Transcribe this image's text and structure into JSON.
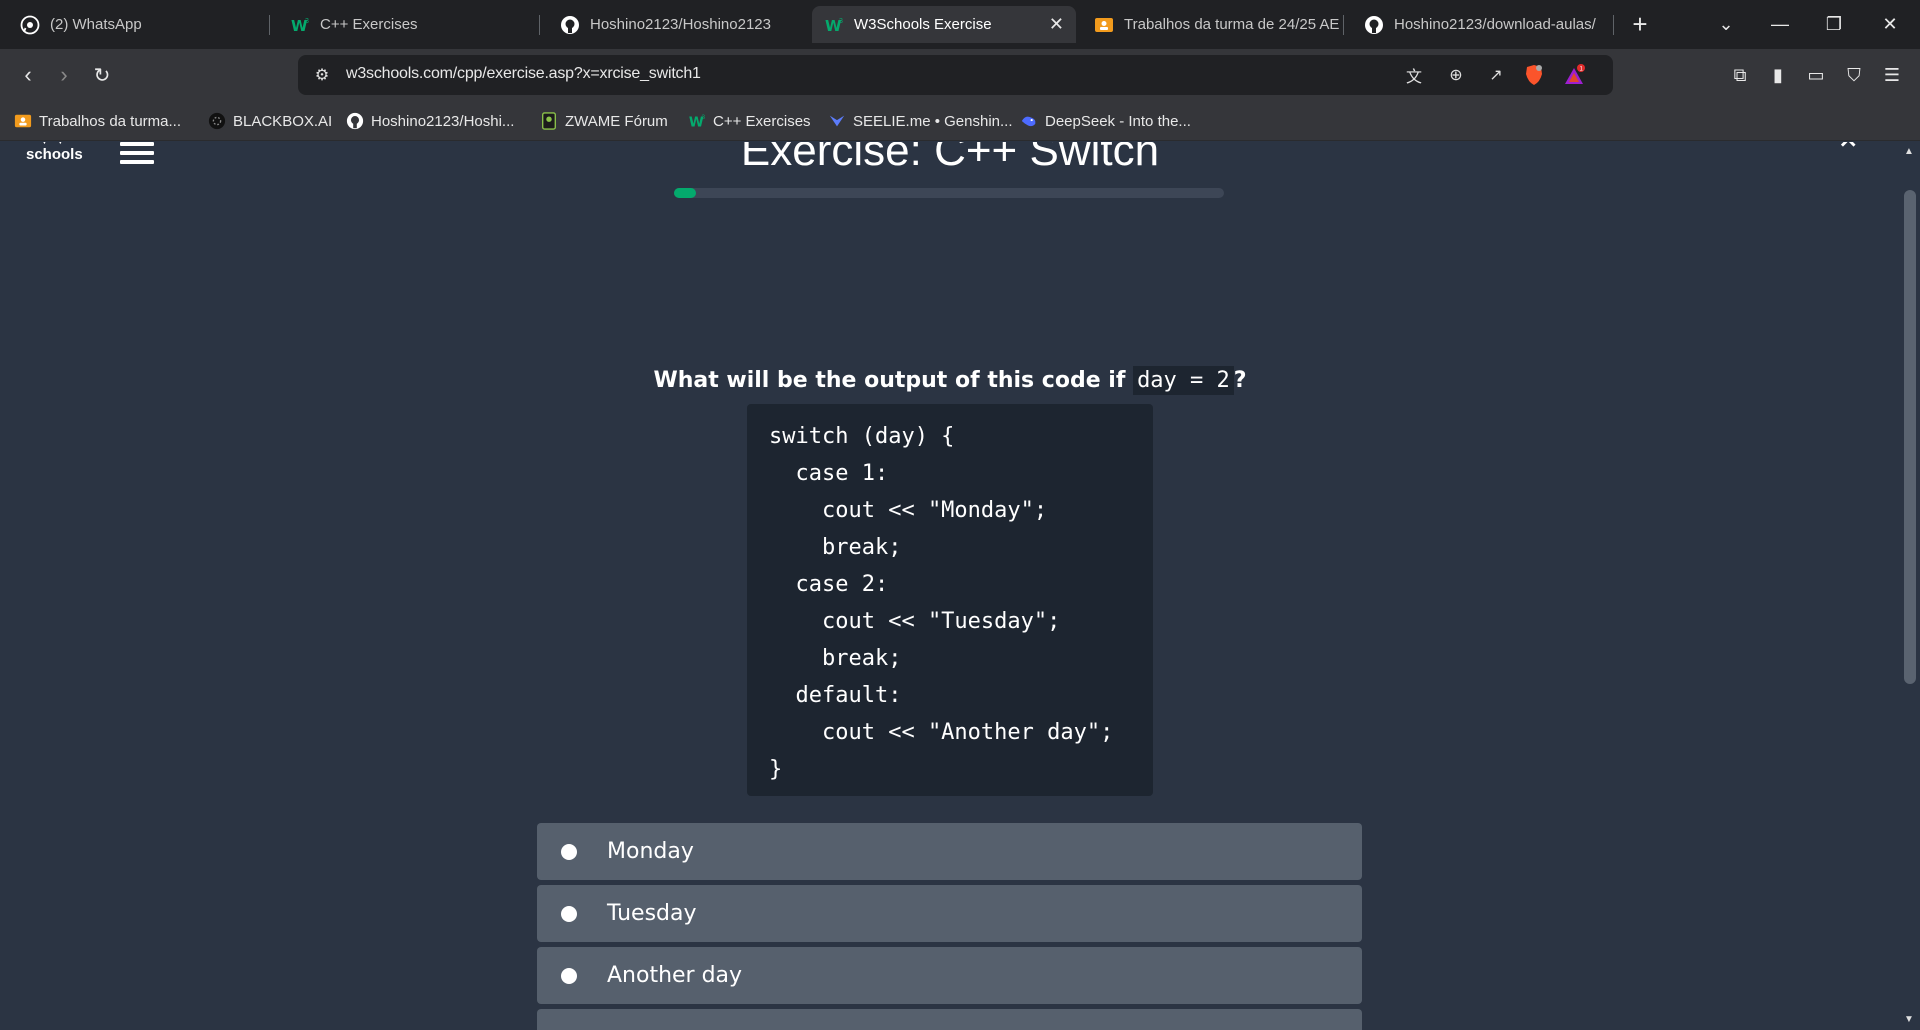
{
  "tabs": [
    {
      "label": "(2) WhatsApp",
      "icon": "whatsapp-icon"
    },
    {
      "label": "C++ Exercises",
      "icon": "w3schools-icon"
    },
    {
      "label": "Hoshino2123/Hoshino2123",
      "icon": "github-icon"
    },
    {
      "label": "W3Schools Exercise",
      "icon": "w3schools-icon",
      "active": true
    },
    {
      "label": "Trabalhos da turma de 24/25 AE",
      "icon": "classroom-icon"
    },
    {
      "label": "Hoshino2123/download-aulas/",
      "icon": "github-icon"
    }
  ],
  "new_tab_label": "+",
  "address": {
    "url": "w3schools.com/cpp/exercise.asp?x=xrcise_switch1"
  },
  "bookmarks": [
    {
      "label": "Trabalhos da turma...",
      "icon": "classroom-icon"
    },
    {
      "label": "BLACKBOX.AI",
      "icon": "blackbox-icon"
    },
    {
      "label": "Hoshino2123/Hoshi...",
      "icon": "github-icon"
    },
    {
      "label": "ZWAME Fórum",
      "icon": "zwame-icon"
    },
    {
      "label": "C++ Exercises",
      "icon": "w3schools-icon"
    },
    {
      "label": "SEELIE.me • Genshin...",
      "icon": "seelie-icon"
    },
    {
      "label": "DeepSeek - Into the...",
      "icon": "deepseek-icon"
    }
  ],
  "page": {
    "logo_text": "schools",
    "title": "Exercise: C++ Switch",
    "progress_fraction": 0.04,
    "question_text": "What will be the output of this code if",
    "question_code": "day = 2",
    "question_suffix": "?",
    "code": "switch (day) {\n  case 1:\n    cout << \"Monday\";\n    break;\n  case 2:\n    cout << \"Tuesday\";\n    break;\n  default:\n    cout << \"Another day\";\n}",
    "options": [
      "Monday",
      "Tuesday",
      "Another day",
      ""
    ]
  },
  "colors": {
    "accent": "#04aa6d",
    "page_bg": "#2b3443",
    "code_bg": "#1d2530",
    "option_bg": "#56606d"
  }
}
